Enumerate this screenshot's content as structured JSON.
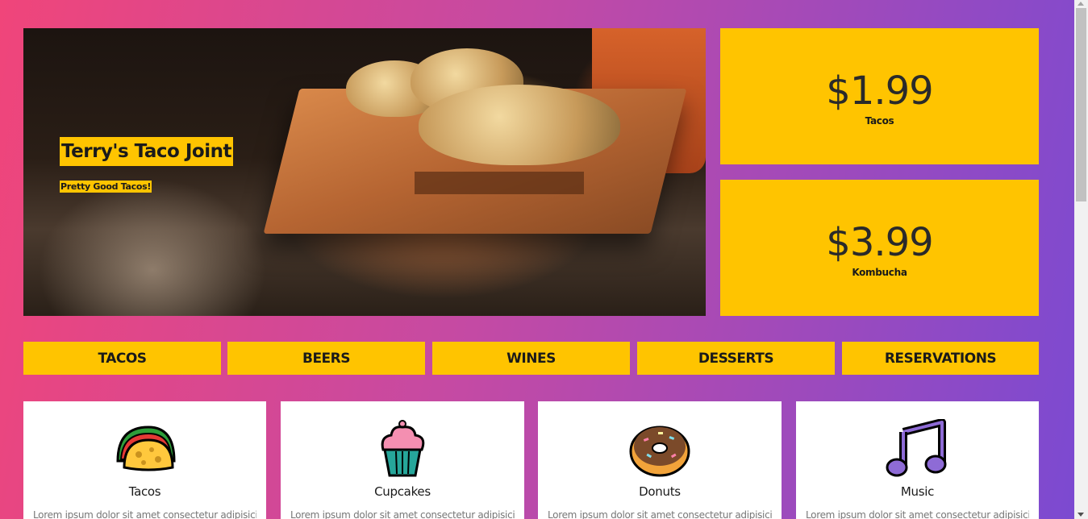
{
  "hero": {
    "title": "Terry's Taco Joint",
    "subtitle": "Pretty Good Tacos!"
  },
  "prices": [
    {
      "price": "$1.99",
      "label": "Tacos"
    },
    {
      "price": "$3.99",
      "label": "Kombucha"
    }
  ],
  "nav": {
    "items": [
      {
        "label": "TACOS"
      },
      {
        "label": "BEERS"
      },
      {
        "label": "WINES"
      },
      {
        "label": "DESSERTS"
      },
      {
        "label": "RESERVATIONS"
      }
    ]
  },
  "cards": [
    {
      "name": "Tacos",
      "icon": "taco-icon",
      "desc": "Lorem ipsum dolor sit amet consectetur adipisicing"
    },
    {
      "name": "Cupcakes",
      "icon": "cupcake-icon",
      "desc": "Lorem ipsum dolor sit amet consectetur adipisicing"
    },
    {
      "name": "Donuts",
      "icon": "donut-icon",
      "desc": "Lorem ipsum dolor sit amet consectetur adipisicing"
    },
    {
      "name": "Music",
      "icon": "music-note-icon",
      "desc": "Lorem ipsum dolor sit amet consectetur adipisicing"
    }
  ],
  "colors": {
    "accent": "#ffc400",
    "gradient_start": "#f0457a",
    "gradient_end": "#7a4ad2"
  }
}
